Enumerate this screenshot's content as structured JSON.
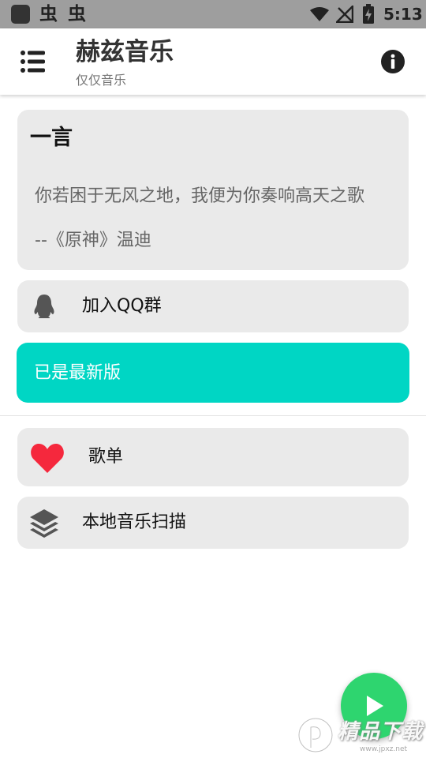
{
  "status_bar": {
    "notification_glyphs": [
      "虫",
      "虫"
    ],
    "time": "5:13",
    "icons": [
      "app-icon",
      "wifi-icon",
      "no-signal-icon",
      "battery-charging-icon"
    ]
  },
  "app_bar": {
    "title": "赫兹音乐",
    "subtitle": "仅仅音乐",
    "icons": [
      "menu-list-icon",
      "info-icon"
    ]
  },
  "quote_card": {
    "title": "一言",
    "text": "你若困于无风之地，我便为你奏响高天之歌",
    "source": "--《原神》温迪"
  },
  "qq_group": {
    "label": "加入QQ群",
    "icon": "qq-penguin-icon"
  },
  "version": {
    "label": "已是最新版",
    "color": "#00d6c4"
  },
  "playlist": {
    "label": "歌单",
    "icon": "heart-icon",
    "icon_color": "#f5283d"
  },
  "local_scan": {
    "label": "本地音乐扫描",
    "icon": "layers-icon"
  },
  "fab": {
    "icon": "play-icon",
    "color": "#2ed56f"
  },
  "watermark": {
    "text": "精品下载",
    "url": "www.jpxz.net"
  }
}
